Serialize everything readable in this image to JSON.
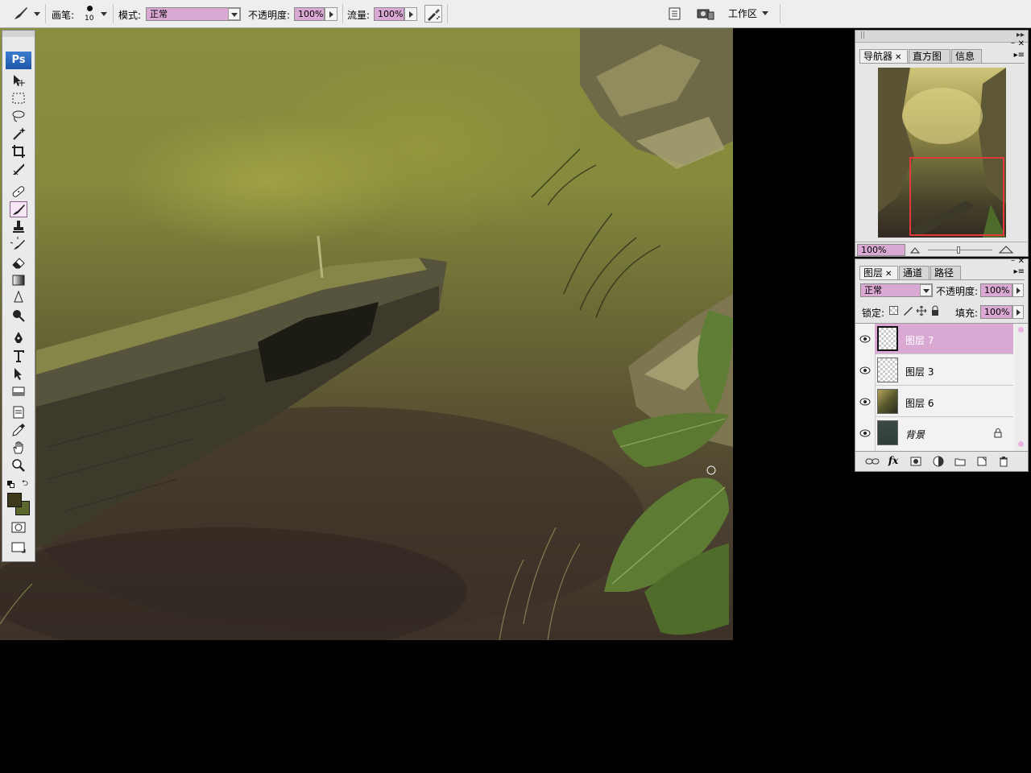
{
  "options_bar": {
    "brush_label": "画笔:",
    "brush_size": "10",
    "mode_label": "模式:",
    "mode_value": "正常",
    "opacity_label": "不透明度:",
    "opacity_value": "100%",
    "flow_label": "流量:",
    "flow_value": "100%",
    "workspace_label": "工作区"
  },
  "toolbox": {
    "logo": "Ps"
  },
  "navigator": {
    "tabs": [
      {
        "label": "导航器",
        "active": true
      },
      {
        "label": "直方图",
        "active": false
      },
      {
        "label": "信息",
        "active": false
      }
    ],
    "zoom": "100%"
  },
  "layers_panel": {
    "tabs": [
      {
        "label": "图层",
        "active": true
      },
      {
        "label": "通道",
        "active": false
      },
      {
        "label": "路径",
        "active": false
      }
    ],
    "blend_mode": "正常",
    "opacity_label": "不透明度:",
    "opacity_value": "100%",
    "lock_label": "锁定:",
    "fill_label": "填充:",
    "fill_value": "100%",
    "layers": [
      {
        "name": "图层 7",
        "selected": true
      },
      {
        "name": "图层 3",
        "selected": false
      },
      {
        "name": "图层 6",
        "selected": false
      },
      {
        "name": "背景",
        "selected": false,
        "locked": true
      }
    ]
  },
  "colors": {
    "selection": "#d9a8d3",
    "foreground": "#3e3a1c",
    "background": "#5b6a2c"
  }
}
